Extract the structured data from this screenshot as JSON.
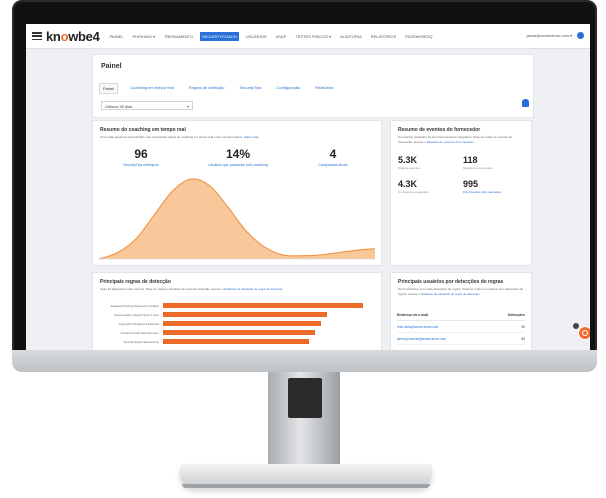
{
  "logo": {
    "prefix": "kn",
    "o": "o",
    "suffix": "wbe4"
  },
  "nav": [
    {
      "label": "PAINEL"
    },
    {
      "label": "PHISHING ▾"
    },
    {
      "label": "TREINAMENTO"
    },
    {
      "label": "SECURITYCOACH",
      "active": true
    },
    {
      "label": "USUÁRIOS"
    },
    {
      "label": "ASAP"
    },
    {
      "label": "TESTES FÍSICOS ▾"
    },
    {
      "label": "AUDITORIA"
    },
    {
      "label": "RELATÓRIOS"
    },
    {
      "label": "PASSWORDIQ"
    }
  ],
  "user": {
    "email": "janna@acmedemo.com ▾"
  },
  "page": {
    "title": "Painel"
  },
  "tabs": [
    {
      "label": "Painel",
      "active": true
    },
    {
      "label": "Coaching em tempo real"
    },
    {
      "label": "Regras de detecção"
    },
    {
      "label": "SecurityTips"
    },
    {
      "label": "Configuração"
    },
    {
      "label": "Relatórios"
    }
  ],
  "range_select": {
    "value": "Últimos 90 dias",
    "caret": "▾"
  },
  "coaching": {
    "title": "Resumo do coaching em tempo real",
    "desc": "Uma visão geral dos SecurityTips, das campanhas ativas de coaching em tempo real e dos usuários ativos.",
    "desc_link": "Saiba mais",
    "stats": [
      {
        "value": "96",
        "label": "SecurityTips entregues"
      },
      {
        "value": "14%",
        "label": "Usuários que passaram pelo coaching"
      },
      {
        "value": "4",
        "label": "Campanhas ativas"
      }
    ]
  },
  "chart_data": {
    "type": "area",
    "values": [
      0.0,
      0.08,
      0.25,
      0.55,
      0.85,
      1.0,
      0.92,
      0.65,
      0.35,
      0.15,
      0.05,
      0.04,
      0.05,
      0.08,
      0.11,
      0.13
    ],
    "title": "",
    "xlabel": "",
    "ylabel": "",
    "color": "#f8c79a",
    "line_color": "#f08a3a"
  },
  "vendor": {
    "title": "Resumo de eventos do fornecedor",
    "desc": "Os eventos coletados de seus fornecedores integrados. Para ver todos os eventos do fornecedor, acesse o",
    "desc_link": "Relatório de eventos do fornecedor",
    "stats": [
      {
        "value": "5.3K",
        "label": "Total de eventos",
        "blue": false
      },
      {
        "value": "118",
        "label": "Usuários com eventos",
        "blue": false
      },
      {
        "value": "4.3K",
        "label": "# e Eventos mapeados",
        "blue": false
      },
      {
        "value": "995",
        "label": "# de Eventos não mapeados",
        "blue": true
      }
    ]
  },
  "rules": {
    "title": "Principais regras de detecção",
    "desc": "Suas 10 detecções mais comuns. Para ver todas a atividade de regra de detecção, acesse o",
    "desc_link": "Relatório de atividade de regra de detecção",
    "bars": [
      {
        "label": "Software Phishing Reported to Incident",
        "value": 100
      },
      {
        "label": "Impersonation Inbound Sent to User",
        "value": 82
      },
      {
        "label": "Copyright Infringement Detected",
        "value": 79
      },
      {
        "label": "Content Growth Detection Item",
        "value": 76
      },
      {
        "label": "Security Report Received by",
        "value": 73
      }
    ]
  },
  "users_table": {
    "title": "Principais usuários por detecções de regras",
    "desc": "Os funcionários com mais detecções de regras. Para ver todos os usuários com detecções de regras, acesse o",
    "desc_link": "Relatório de atividade de regra de detecção.",
    "headers": [
      "Endereço de e-mail",
      "Detecções"
    ],
    "rows": [
      {
        "email": "rose.dicks@acme-demo.com",
        "count": "90"
      },
      {
        "email": "james.jeunesse@acme-demo.com",
        "count": "84"
      }
    ]
  }
}
